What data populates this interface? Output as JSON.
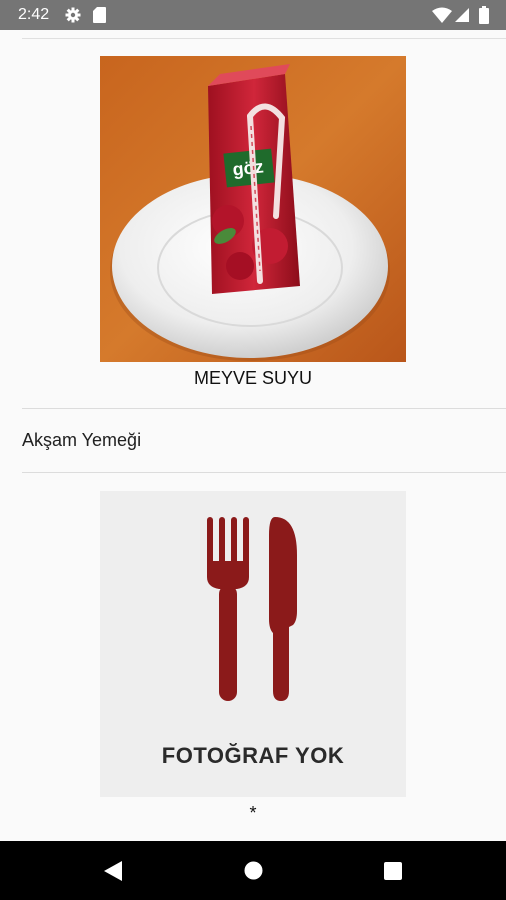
{
  "status_bar": {
    "time": "2:42",
    "icons": [
      "gear-icon",
      "sd-card-icon",
      "wifi-icon",
      "signal-icon",
      "battery-icon"
    ]
  },
  "items": [
    {
      "photo": "juice-carton-photo",
      "caption": "MEYVE SUYU"
    }
  ],
  "meal": {
    "title": "Akşam Yemeği",
    "placeholder_text": "FOTOĞRAF YOK",
    "caption": "*"
  },
  "nav_bar": {
    "buttons": [
      "back-icon",
      "home-icon",
      "recents-icon"
    ]
  },
  "colors": {
    "status_bar": "#757575",
    "background": "#fafafa",
    "utensil": "#8b1a1a",
    "nav_bar": "#000000"
  }
}
